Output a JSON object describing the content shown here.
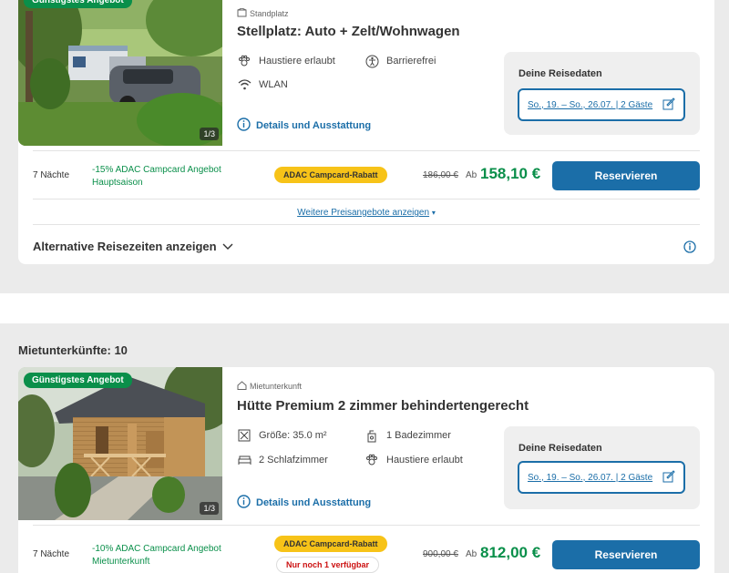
{
  "listings": [
    {
      "badge": "Günstigstes Angebot",
      "image_counter": "1/3",
      "type_label": "Standplatz",
      "title": "Stellplatz: Auto + Zelt/Wohnwagen",
      "features": [
        {
          "icon": "paw-icon",
          "label": "Haustiere erlaubt"
        },
        {
          "icon": "accessibility-icon",
          "label": "Barrierefrei"
        },
        {
          "icon": "wifi-icon",
          "label": "WLAN"
        }
      ],
      "details_link": "Details und Ausstattung",
      "dates_title": "Deine Reisedaten",
      "dates_value": "So., 19. – So., 26.07. | 2 Gäste",
      "offer": {
        "nights": "7 Nächte",
        "promo_line1": "-15% ADAC Campcard Angebot",
        "promo_line2": "Hauptsaison",
        "rabatt_badge": "ADAC Campcard-Rabatt",
        "old_price": "186,00 €",
        "ab": "Ab",
        "price": "158,10 €",
        "reserve": "Reservieren"
      },
      "more_offers": "Weitere Preisangebote anzeigen",
      "more_offers_arrow": "▾",
      "alt_times": "Alternative Reisezeiten anzeigen"
    },
    {
      "badge": "Günstigstes Angebot",
      "image_counter": "1/3",
      "type_label": "Mietunterkunft",
      "title": "Hütte Premium 2 zimmer behindertengerecht",
      "features": [
        {
          "icon": "size-icon",
          "label": "Größe: 35.0 m²"
        },
        {
          "icon": "bathroom-icon",
          "label": "1 Badezimmer"
        },
        {
          "icon": "bed-icon",
          "label": "2 Schlafzimmer"
        },
        {
          "icon": "paw-icon",
          "label": "Haustiere erlaubt"
        }
      ],
      "details_link": "Details und Ausstattung",
      "dates_title": "Deine Reisedaten",
      "dates_value": "So., 19. – So., 26.07. | 2 Gäste",
      "offer": {
        "nights": "7 Nächte",
        "promo_line1": "-10% ADAC Campcard Angebot",
        "promo_line2": "Mietunterkunft",
        "rabatt_badge": "ADAC Campcard-Rabatt",
        "availability": "Nur noch 1 verfügbar",
        "old_price": "900,00 €",
        "ab": "Ab",
        "price": "812,00 €",
        "reserve": "Reservieren"
      }
    }
  ],
  "section_heading": "Mietunterkünfte: 10",
  "colors": {
    "brand_blue": "#1b6ea8",
    "price_green": "#0a8f4a",
    "badge_yellow": "#f7c318",
    "alert_red": "#cc1111"
  }
}
